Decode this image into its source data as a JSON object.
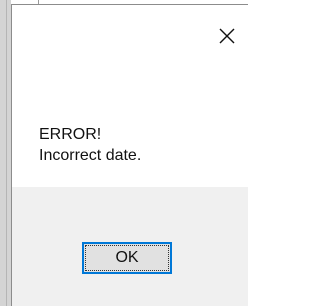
{
  "dialog": {
    "close_icon": "close-icon",
    "message": {
      "line1": "ERROR!",
      "line2": "Incorrect date."
    },
    "ok_label": "OK"
  },
  "colors": {
    "focus_border": "#0078d7",
    "footer_bg": "#f0f0f0",
    "button_bg": "#e1e1e1",
    "background_window": "#d4d4d4"
  }
}
